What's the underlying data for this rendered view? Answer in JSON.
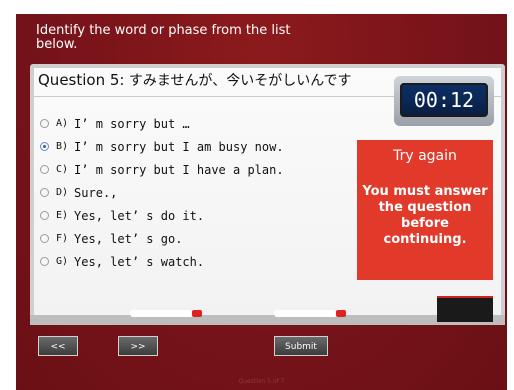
{
  "instruction": "Identify the word or phase from the list below.",
  "question": {
    "label": "Question 5:",
    "text": "すみませんが、今いそがしいんです"
  },
  "timer": "00:12",
  "options": [
    {
      "letter": "A)",
      "text": "I’ m sorry but …",
      "selected": false
    },
    {
      "letter": "B)",
      "text": "I’ m sorry but I am busy now.",
      "selected": true
    },
    {
      "letter": "C)",
      "text": "I’ m sorry but I have a plan.",
      "selected": false
    },
    {
      "letter": "D)",
      "text": "Sure.,",
      "selected": false
    },
    {
      "letter": "E)",
      "text": "Yes, let’ s do it.",
      "selected": false
    },
    {
      "letter": "F)",
      "text": "Yes, let’ s go.",
      "selected": false
    },
    {
      "letter": "G)",
      "text": "Yes, let’ s watch.",
      "selected": false
    }
  ],
  "feedback": {
    "title": "Try again",
    "message": "You must answer the question before continuing."
  },
  "nav": {
    "prev_label": "<<",
    "next_label": ">>",
    "submit_label": "Submit"
  },
  "footer": "Question 5 of 7",
  "colors": {
    "background": "#7a1416",
    "feedback": "#e13a2a",
    "timer_screen": "#0c2f66"
  }
}
